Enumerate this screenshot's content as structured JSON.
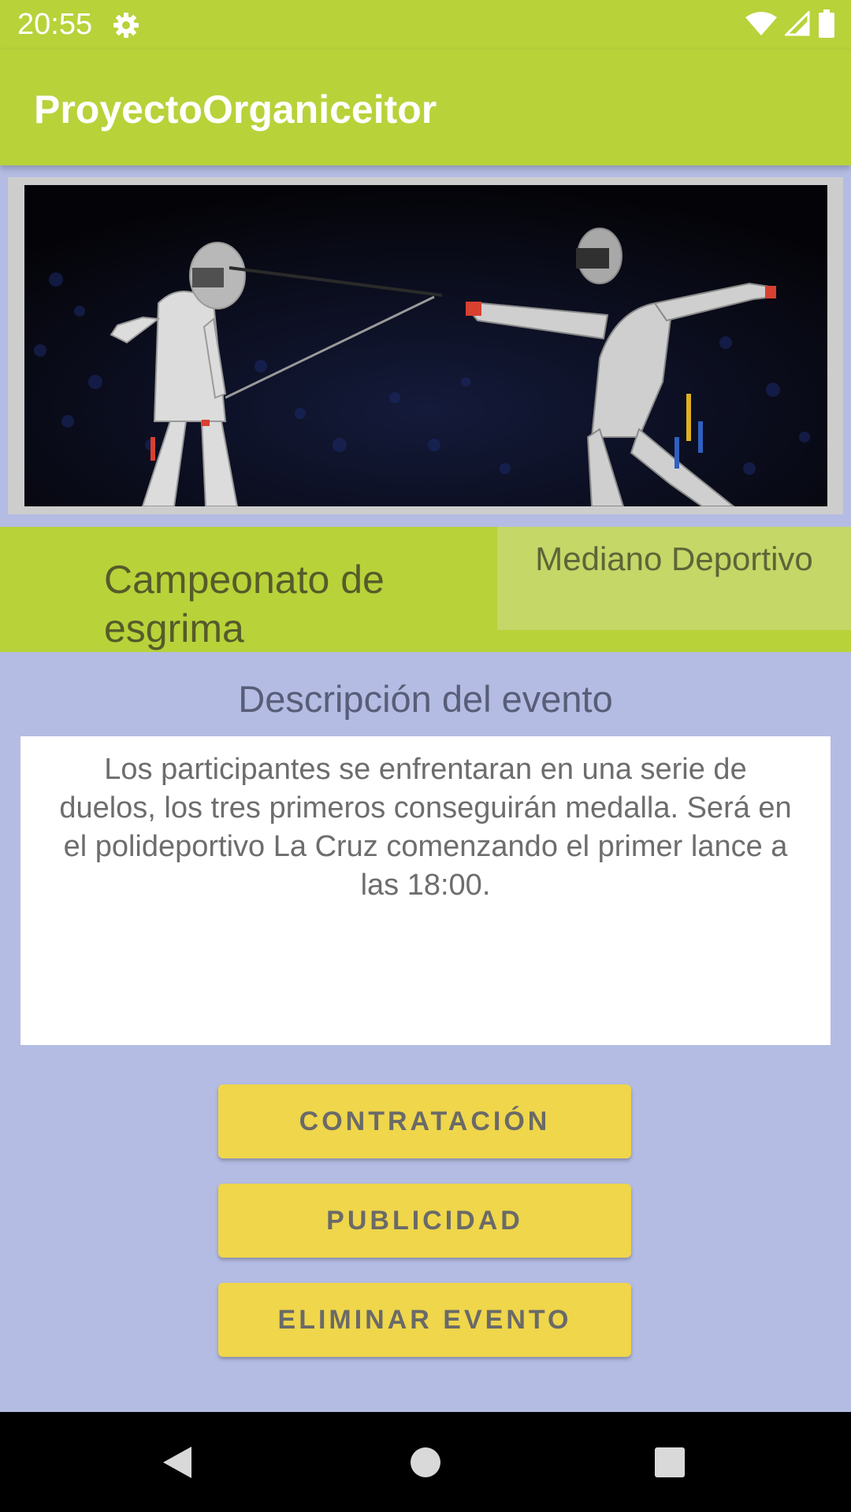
{
  "status_bar": {
    "time": "20:55",
    "icons": [
      "settings-icon",
      "wifi-icon",
      "signal-icon",
      "battery-icon"
    ]
  },
  "app_bar": {
    "title": "ProyectoOrganiceitor"
  },
  "event": {
    "image": "fencing-match-photo",
    "name": "Campeonato de esgrima",
    "tag": "Mediano Deportivo",
    "description_title": "Descripción del evento",
    "description": "Los participantes se enfrentaran en una serie de duelos, los tres primeros conseguirán medalla. Será en el polideportivo La Cruz comenzando el primer lance a las 18:00."
  },
  "buttons": {
    "hiring": "CONTRATACIÓN",
    "advertising": "PUBLICIDAD",
    "delete": "ELIMINAR EVENTO"
  },
  "nav_bar": {
    "icons": [
      "back-icon",
      "home-icon",
      "recents-icon"
    ]
  },
  "colors": {
    "primary": "#B8D23A",
    "background": "#B4BCE3",
    "button": "#EFD64B",
    "tag_background": "#C4D767"
  }
}
